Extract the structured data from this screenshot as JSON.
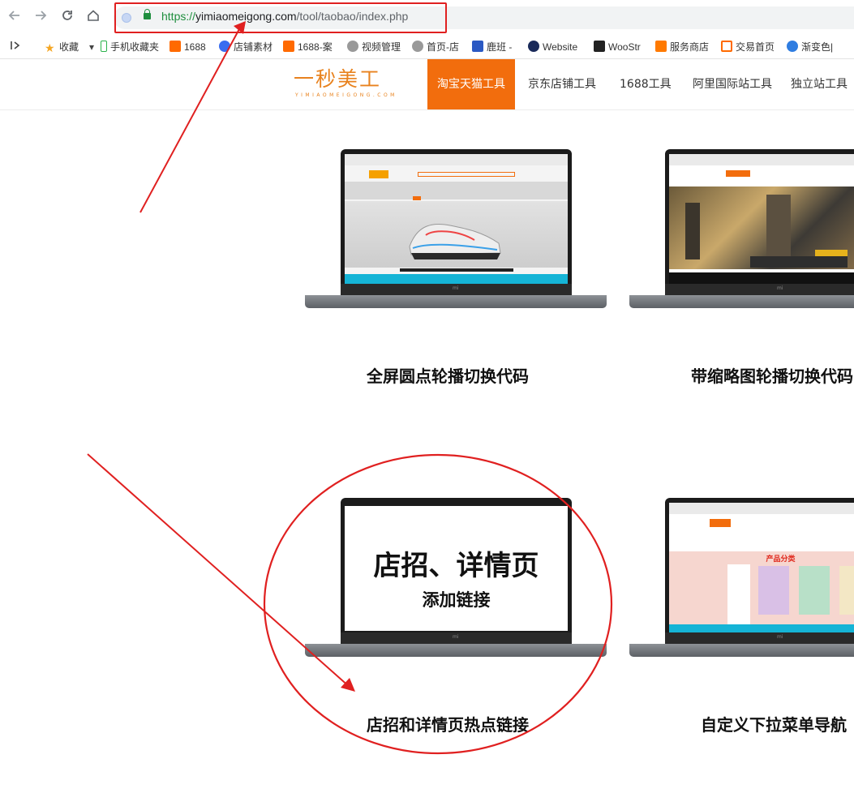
{
  "browser": {
    "back_icon": "arrow-left-icon",
    "forward_icon": "arrow-right-icon",
    "reload_icon": "reload-icon",
    "home_icon": "home-icon",
    "url_scheme": "https://",
    "url_host": "yimiaomeigong.com",
    "url_path": "/tool/taobao/index.php"
  },
  "bookmarks": [
    {
      "label": "收藏",
      "icon": "star-icon",
      "color": "#f5a623"
    },
    {
      "label": "手机收藏夹",
      "icon": "phone-icon",
      "color": "#2bb24c"
    },
    {
      "label": "1688",
      "icon": "1688-icon",
      "color": "#ff6a00"
    },
    {
      "label": "店铺素材",
      "icon": "shop-icon",
      "color": "#3a6df0"
    },
    {
      "label": "1688-案",
      "icon": "1688-icon",
      "color": "#ff6a00"
    },
    {
      "label": "视频管理",
      "icon": "globe-icon",
      "color": "#777777"
    },
    {
      "label": "首页-店",
      "icon": "globe-icon",
      "color": "#777777"
    },
    {
      "label": "鹿班 -",
      "icon": "luban-icon",
      "color": "#2b59c3"
    },
    {
      "label": "Website",
      "icon": "shield-icon",
      "color": "#1a2a5a"
    },
    {
      "label": "WooStr",
      "icon": "woo-icon",
      "color": "#222222"
    },
    {
      "label": "服务商店",
      "icon": "taobao-icon",
      "color": "#ff7a00"
    },
    {
      "label": "交易首页",
      "icon": "alibaba-icon",
      "color": "#ff6a00"
    },
    {
      "label": "渐变色|",
      "icon": "color-icon",
      "color": "#2f7de1"
    }
  ],
  "site": {
    "logo_text": "一秒美工",
    "logo_sub": "YIMIAOMEIGONG.COM",
    "nav": [
      "淘宝天猫工具",
      "京东店铺工具",
      "1688工具",
      "阿里国际站工具",
      "独立站工具"
    ],
    "accent": "#f26d0d"
  },
  "cards": [
    {
      "title": "全屏圆点轮播切换代码"
    },
    {
      "title": "带缩略图轮播切换代码"
    },
    {
      "title": "店招和详情页热点链接",
      "poster_main": "店招、详情页",
      "poster_sub": "添加链接"
    },
    {
      "title": "自定义下拉菜单导航",
      "screen_heading": "产品分类"
    }
  ],
  "annotation_color": "#e02020"
}
